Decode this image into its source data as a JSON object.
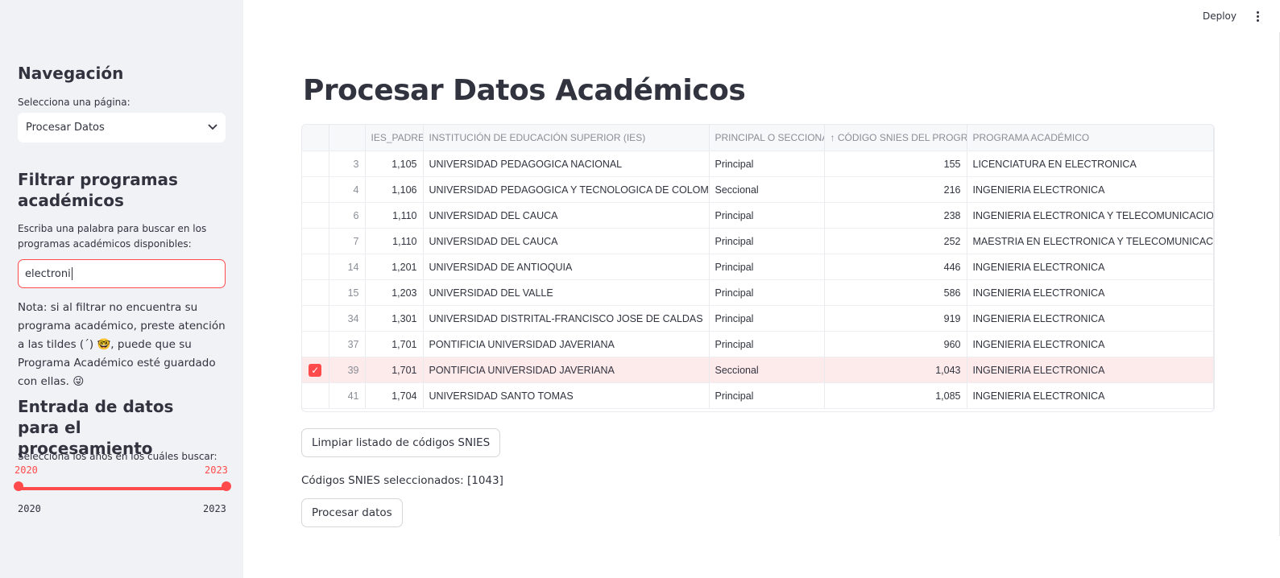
{
  "topbar": {
    "deploy_label": "Deploy"
  },
  "sidebar": {
    "nav_title": "Navegación",
    "page_select_label": "Selecciona una página:",
    "page_select_value": "Procesar Datos",
    "filter_title": "Filtrar programas académicos",
    "filter_label": "Escriba una palabra para buscar en los programas académicos disponibles:",
    "filter_value": "electroni",
    "note_text": "Nota: si al filtrar no encuentra su programa académico, preste atención a las tildes (´) 🤓, puede que su Programa Académico esté guardado con ellas. 😜",
    "data_entry_title": "Entrada de datos para el procesamiento",
    "years_label": "Selecciona los años en los cuáles buscar:",
    "slider": {
      "value_min": "2020",
      "value_max": "2023",
      "range_min": "2020",
      "range_max": "2023"
    }
  },
  "main": {
    "title": "Procesar Datos Académicos",
    "table": {
      "columns": [
        "",
        "",
        "IES_PADRE",
        "INSTITUCIÓN DE EDUCACIÓN SUPERIOR (IES)",
        "PRINCIPAL O SECCIONAL",
        "↑ CÓDIGO SNIES DEL PROGRAMA",
        "PROGRAMA ACADÉMICO"
      ],
      "rows": [
        {
          "checked": false,
          "index": "3",
          "ies_padre": "1,105",
          "institucion": "UNIVERSIDAD PEDAGOGICA NACIONAL",
          "tipo": "Principal",
          "snies": "155",
          "programa": "LICENCIATURA EN ELECTRONICA"
        },
        {
          "checked": false,
          "index": "4",
          "ies_padre": "1,106",
          "institucion": "UNIVERSIDAD PEDAGOGICA Y TECNOLOGICA DE COLOMBIA - UPTC",
          "tipo": "Seccional",
          "snies": "216",
          "programa": "INGENIERIA ELECTRONICA"
        },
        {
          "checked": false,
          "index": "6",
          "ies_padre": "1,110",
          "institucion": "UNIVERSIDAD DEL CAUCA",
          "tipo": "Principal",
          "snies": "238",
          "programa": "INGENIERIA ELECTRONICA Y TELECOMUNICACIONES"
        },
        {
          "checked": false,
          "index": "7",
          "ies_padre": "1,110",
          "institucion": "UNIVERSIDAD DEL CAUCA",
          "tipo": "Principal",
          "snies": "252",
          "programa": "MAESTRIA EN ELECTRONICA Y TELECOMUNICACIONES"
        },
        {
          "checked": false,
          "index": "14",
          "ies_padre": "1,201",
          "institucion": "UNIVERSIDAD DE ANTIOQUIA",
          "tipo": "Principal",
          "snies": "446",
          "programa": "INGENIERIA ELECTRONICA"
        },
        {
          "checked": false,
          "index": "15",
          "ies_padre": "1,203",
          "institucion": "UNIVERSIDAD DEL VALLE",
          "tipo": "Principal",
          "snies": "586",
          "programa": "INGENIERIA ELECTRONICA"
        },
        {
          "checked": false,
          "index": "34",
          "ies_padre": "1,301",
          "institucion": "UNIVERSIDAD DISTRITAL-FRANCISCO JOSE DE CALDAS",
          "tipo": "Principal",
          "snies": "919",
          "programa": "INGENIERIA ELECTRONICA"
        },
        {
          "checked": false,
          "index": "37",
          "ies_padre": "1,701",
          "institucion": "PONTIFICIA UNIVERSIDAD JAVERIANA",
          "tipo": "Principal",
          "snies": "960",
          "programa": "INGENIERIA ELECTRONICA"
        },
        {
          "checked": true,
          "index": "39",
          "ies_padre": "1,701",
          "institucion": "PONTIFICIA UNIVERSIDAD JAVERIANA",
          "tipo": "Seccional",
          "snies": "1,043",
          "programa": "INGENIERIA ELECTRONICA"
        },
        {
          "checked": false,
          "index": "41",
          "ies_padre": "1,704",
          "institucion": "UNIVERSIDAD SANTO TOMAS",
          "tipo": "Principal",
          "snies": "1,085",
          "programa": "INGENIERIA ELECTRONICA"
        }
      ]
    },
    "clear_button": "Limpiar listado de códigos SNIES",
    "selected_text": "Códigos SNIES seleccionados: [1043]",
    "process_button": "Procesar datos"
  }
}
